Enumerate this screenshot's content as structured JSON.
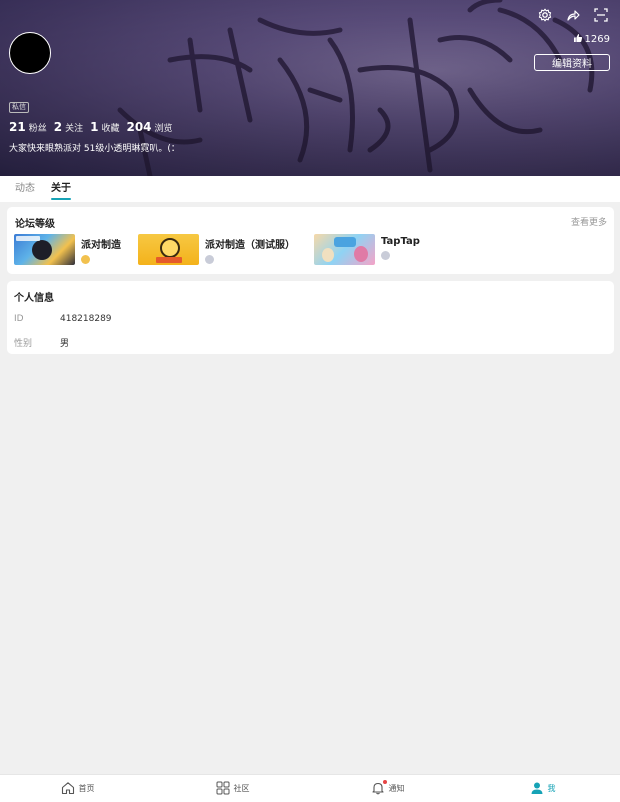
{
  "header": {
    "likes": "1269",
    "edit_button": "编辑资料",
    "tag": "私信",
    "stats": [
      {
        "num": "21",
        "label": "粉丝"
      },
      {
        "num": "2",
        "label": "关注"
      },
      {
        "num": "1",
        "label": "收藏"
      },
      {
        "num": "204",
        "label": "浏览"
      }
    ],
    "bio": "大家快来眼熟派对 51级小透明琳霓叭。(："
  },
  "tabs": [
    {
      "label": "动态",
      "active": false
    },
    {
      "label": "关于",
      "active": true
    }
  ],
  "forum": {
    "title": "论坛等级",
    "more": "查看更多",
    "games": [
      {
        "name": "派对制造",
        "badge_color": "#f2c14e"
      },
      {
        "name": "派对制造（测试服）",
        "badge_color": "#c9ccd8"
      },
      {
        "name": "TapTap",
        "badge_color": "#c9ccd8"
      }
    ]
  },
  "personal": {
    "title": "个人信息",
    "rows": [
      {
        "key": "ID",
        "value": "418218289"
      },
      {
        "key": "性别",
        "value": "男"
      }
    ]
  },
  "nav": [
    {
      "label": "首页",
      "icon": "home-icon"
    },
    {
      "label": "社区",
      "icon": "community-grid-icon"
    },
    {
      "label": "通知",
      "icon": "bell-icon"
    },
    {
      "label": "我",
      "icon": "user-icon"
    }
  ],
  "colors": {
    "accent": "#16a3b6",
    "banner": "#5f5182",
    "notify_dot": "#e64545"
  }
}
